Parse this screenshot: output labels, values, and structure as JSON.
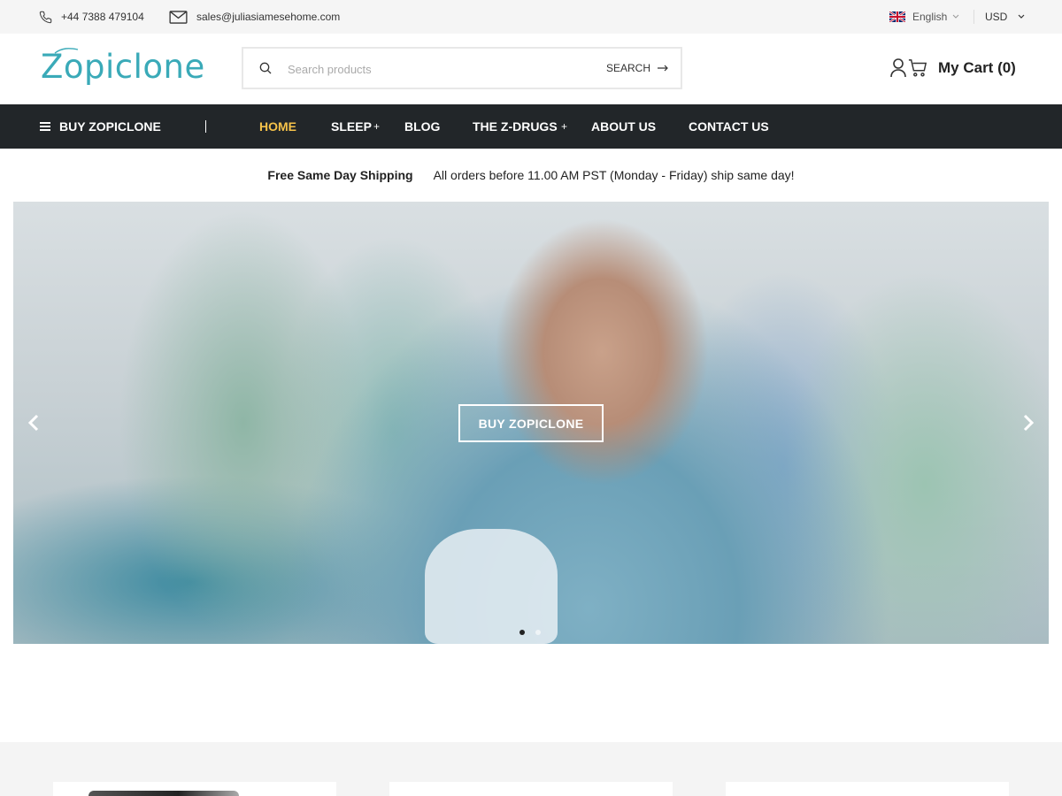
{
  "topbar": {
    "phone": "+44 7388 479104",
    "email": "sales@juliasiamesehome.com",
    "language": "English",
    "currency": "USD"
  },
  "header": {
    "logo_text": "Zopiclone",
    "search_placeholder": "Search products",
    "search_button": "SEARCH",
    "cart_label": "My Cart (0)"
  },
  "nav": {
    "category_label": "BUY ZOPICLONE",
    "items": [
      {
        "label": "HOME",
        "active": true
      },
      {
        "label": "SLEEP",
        "has_submenu": true
      },
      {
        "label": "BLOG"
      },
      {
        "label": "THE Z-DRUGS",
        "has_submenu": true
      },
      {
        "label": "ABOUT US"
      },
      {
        "label": "CONTACT US"
      }
    ],
    "submenu_symbol": "+"
  },
  "shipping": {
    "title": "Free Same Day Shipping",
    "text": "All orders before 11.00 AM PST (Monday - Friday) ship same day!"
  },
  "hero": {
    "cta_label": "BUY ZOPICLONE",
    "slides_total": 2,
    "active_slide": 1
  },
  "colors": {
    "accent": "#3aaab8",
    "nav_bg": "#222629",
    "nav_active": "#f5c24a"
  },
  "icons": {
    "phone": "phone-icon",
    "email": "envelope-icon",
    "flag": "uk-flag-icon",
    "search": "search-icon",
    "account": "user-icon",
    "cart": "cart-icon",
    "menu": "hamburger-icon"
  }
}
